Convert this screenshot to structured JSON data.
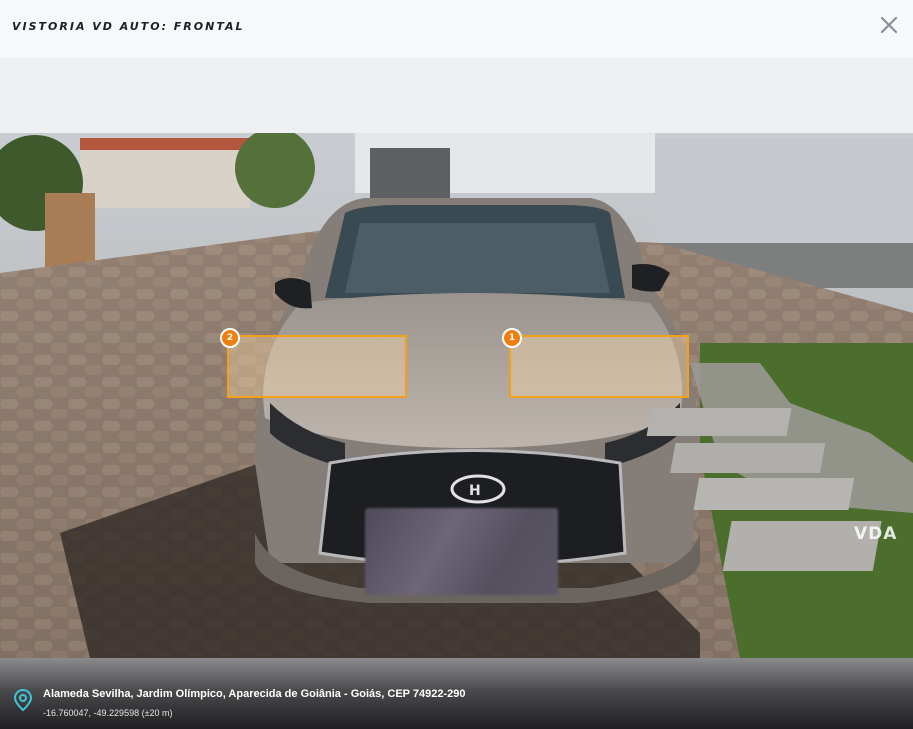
{
  "header": {
    "title": "VISTORIA VD AUTO: FRONTAL",
    "close_icon": "close-icon"
  },
  "photo": {
    "damage_markers": [
      {
        "number": "1"
      },
      {
        "number": "2"
      }
    ],
    "watermark": "VDA"
  },
  "location": {
    "icon": "map-pin-icon",
    "address": "Alameda Sevilha, Jardim Olímpico, Aparecida de Goiânia - Goiás, CEP 74922-290",
    "coordinates": "-16.760047, -49.229598 (±20 m)",
    "accent_color": "#3ec6d6"
  }
}
